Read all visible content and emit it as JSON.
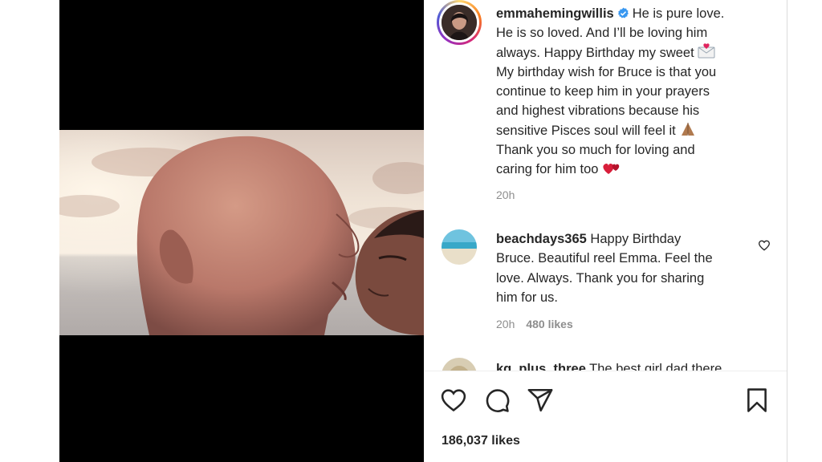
{
  "post": {
    "caption_user": "emmahemingwillis",
    "caption_lines": [
      "He is pure love.",
      "He is so loved. And I’ll be loving him",
      "always. Happy Birthday my sweet",
      "My birthday wish for Bruce is that you",
      "continue to keep him in your prayers",
      "and highest vibrations because his",
      "sensitive Pisces soul will feel it",
      "Thank you so much for loving and",
      "caring for him too"
    ],
    "caption_time": "20h"
  },
  "comments": [
    {
      "user": "beachdays365",
      "lines": [
        "Happy Birthday",
        "Bruce. Beautiful reel Emma. Feel the",
        "love. Always. Thank you for sharing",
        "him for us."
      ],
      "time": "20h",
      "likes": "480 likes"
    },
    {
      "user": "kg_plus_three",
      "text": "The best girl dad there"
    }
  ],
  "footer": {
    "likes": "186,037 likes"
  },
  "icons": {
    "like": "heart-icon",
    "comment": "comment-icon",
    "share": "share-icon",
    "save": "bookmark-icon",
    "verified": "verified-badge-icon",
    "comment_like": "heart-small-icon"
  },
  "colors": {
    "verified": "#3897f0",
    "text": "#262626",
    "secondary": "#8e8e8e",
    "media_bg": "#000000"
  }
}
